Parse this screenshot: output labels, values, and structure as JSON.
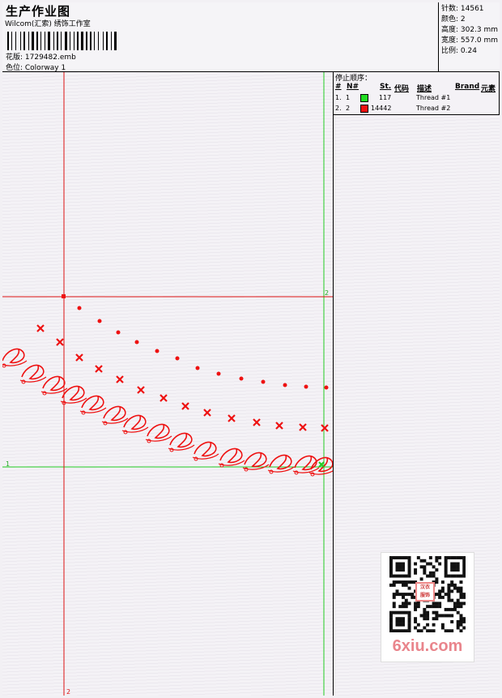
{
  "header": {
    "title": "生产作业图",
    "studio": "Wilcom(汇索) 绣饰工作室",
    "design_file": "花版:  1729482.emb",
    "colorway": "色位:  Colorway 1"
  },
  "stats": {
    "stitches": "针数:  14561",
    "colors": "颜色:  2",
    "height": "高度:  302.3 mm",
    "width": "宽度:  557.0 mm",
    "scale": "比例:  0.24"
  },
  "thread_table": {
    "title": "停止顺序：",
    "headers": [
      "#",
      "N#",
      "St.",
      "代码",
      "描述",
      "Brand",
      "元素"
    ],
    "rows": [
      {
        "index": "1.",
        "n": "1",
        "color": "#22dd22",
        "code": "117",
        "desc": "Thread #1"
      },
      {
        "index": "2.",
        "n": "2",
        "color": "#ee1111",
        "code": "14442",
        "desc": "Thread #2"
      }
    ]
  },
  "canvas": {
    "marker_1": "1",
    "marker_2": "2",
    "marker_2b": "2",
    "stitch_color": "#ee1111",
    "guide_color_green": "#22cc22",
    "guide_color_red": "#dd1111"
  },
  "watermark": {
    "brand": "6xiu.com",
    "qr_text": "汉衣\n服饰"
  }
}
